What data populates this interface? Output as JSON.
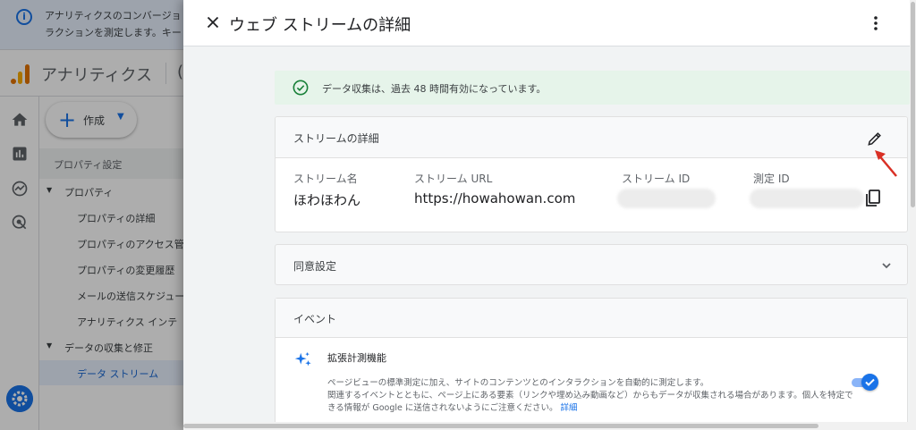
{
  "background": {
    "banner_text": "アナリティクスのコンバージョ\nラクションを測定します。キー",
    "app_name": "アナリティクス",
    "account_fragment": "(",
    "create_button": "作成",
    "nav_header": "プロパティ設定",
    "nav_items": [
      {
        "label": "プロパティ"
      },
      {
        "label": "プロパティの詳細"
      },
      {
        "label": "プロパティのアクセス管"
      },
      {
        "label": "プロパティの変更履歴"
      },
      {
        "label": "メールの送信スケジュー"
      },
      {
        "label": "アナリティクス インテ"
      },
      {
        "label": "データの収集と修正"
      },
      {
        "label": "データ ストリーム"
      }
    ]
  },
  "panel": {
    "title": "ウェブ ストリームの詳細",
    "success_message": "データ収集は、過去 48 時間有効になっています。",
    "details": {
      "title": "ストリームの詳細",
      "labels": {
        "name": "ストリーム名",
        "url": "ストリーム URL",
        "id": "ストリーム ID",
        "measurement": "測定 ID"
      },
      "values": {
        "name": "ほわほわん",
        "url": "https://howahowan.com"
      }
    },
    "consent": {
      "title": "同意設定"
    },
    "events": {
      "title": "イベント",
      "enhanced": {
        "title": "拡張計測機能",
        "description": "ページビューの標準測定に加え、サイトのコンテンツとのインタラクションを自動的に測定します。\n関連するイベントとともに、ページ上にある要素（リンクや埋め込み動画など）からもデータが収集される場合があります。個人を特定できる情報が Google に送信されないようにご注意ください。",
        "more_link": "詳細",
        "enabled": true
      }
    }
  },
  "colors": {
    "accent": "#1a73e8",
    "success_bg": "#e6f4ea",
    "success_icon": "#188038",
    "annotation_arrow": "#d93025"
  }
}
